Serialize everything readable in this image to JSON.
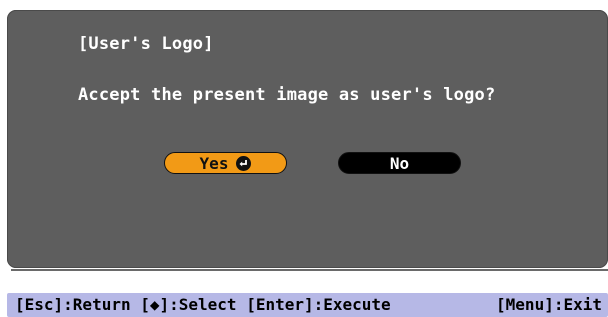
{
  "dialog": {
    "title": "[User's Logo]",
    "question": "Accept the present image as user's logo?",
    "buttons": {
      "yes_label": "Yes",
      "yes_icon": "enter-icon",
      "no_label": "No"
    }
  },
  "statusbar": {
    "left_text": "[Esc]:Return [◆]:Select [Enter]:Execute",
    "right_text": "[Menu]:Exit"
  },
  "colors": {
    "dialog_bg": "#5e5e5e",
    "selected_button": "#f29a16",
    "unselected_button": "#000000",
    "statusbar_bg": "#b6b8e6"
  }
}
